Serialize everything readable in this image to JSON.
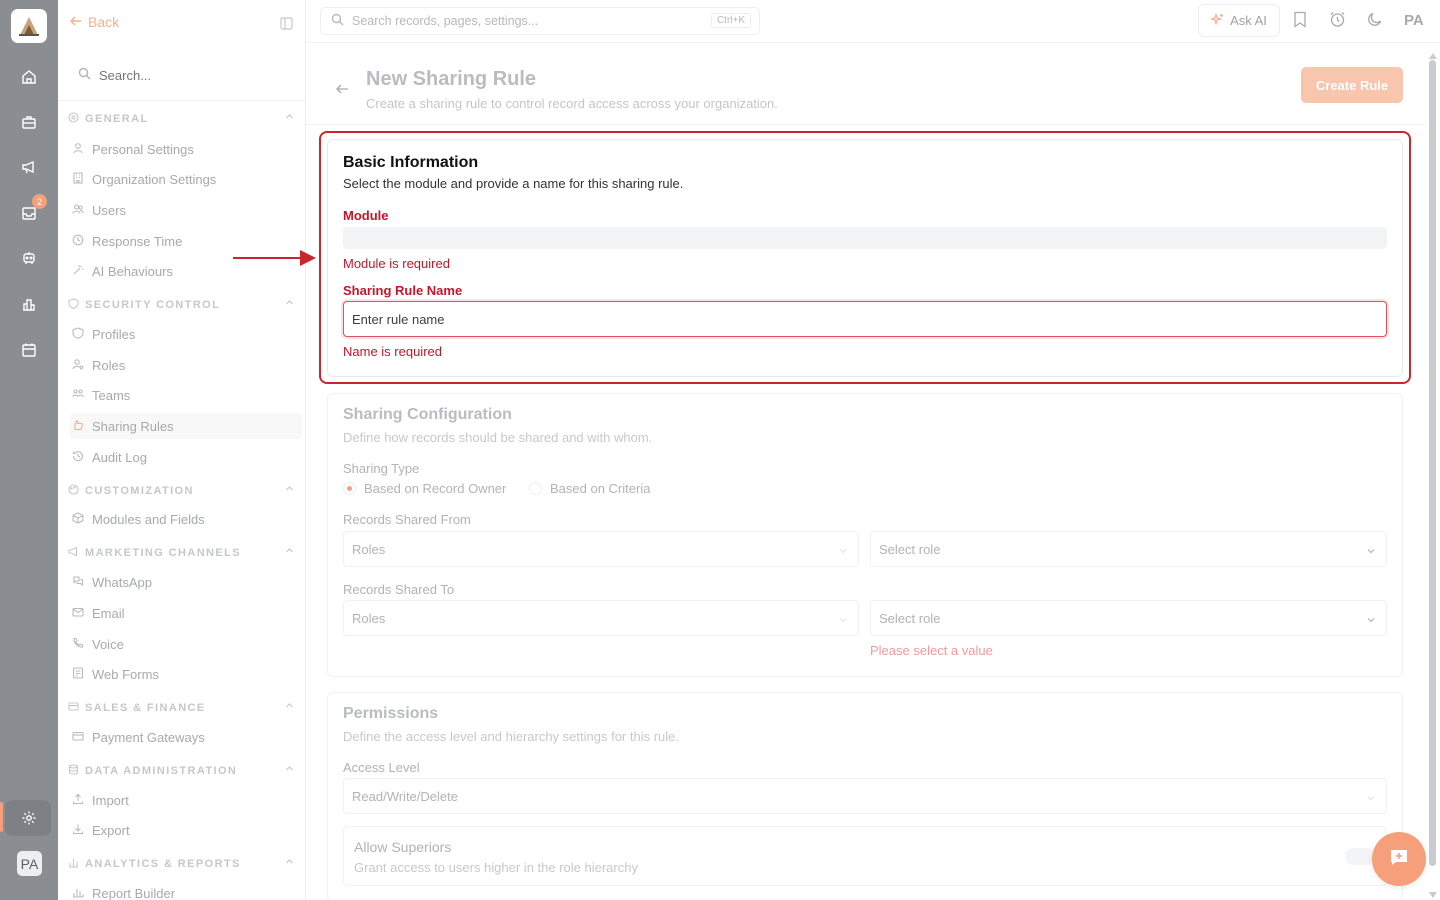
{
  "rail": {
    "badge_count": "2",
    "avatar": "PA",
    "icons": [
      "home-icon",
      "briefcase-icon",
      "megaphone-icon",
      "inbox-icon",
      "robot-icon",
      "bar-chart-icon",
      "calendar-icon",
      "settings-icon"
    ]
  },
  "sidebar": {
    "back_label": "Back",
    "search_placeholder": "Search...",
    "sections": {
      "general": "GENERAL",
      "security": "SECURITY CONTROL",
      "customization": "CUSTOMIZATION",
      "marketing": "MARKETING CHANNELS",
      "sales": "SALES & FINANCE",
      "data": "DATA ADMINISTRATION",
      "analytics": "ANALYTICS & REPORTS"
    },
    "items": {
      "personal": "Personal Settings",
      "organization": "Organization Settings",
      "users": "Users",
      "response": "Response Time",
      "ai": "AI Behaviours",
      "profiles": "Profiles",
      "roles": "Roles",
      "teams": "Teams",
      "sharing": "Sharing Rules",
      "audit": "Audit Log",
      "modules": "Modules and Fields",
      "whatsapp": "WhatsApp",
      "email": "Email",
      "voice": "Voice",
      "webforms": "Web Forms",
      "payment": "Payment Gateways",
      "import": "Import",
      "export": "Export",
      "report": "Report Builder"
    }
  },
  "topbar": {
    "search_placeholder": "Search records, pages, settings...",
    "shortcut": "Ctrl+K",
    "ask_ai": "Ask AI",
    "avatar": "PA"
  },
  "page": {
    "title": "New Sharing Rule",
    "subtitle": "Create a sharing rule to control record access across your organization.",
    "create_button": "Create Rule"
  },
  "basic": {
    "title": "Basic Information",
    "subtitle": "Select the module and provide a name for this sharing rule.",
    "module_label": "Module",
    "module_error": "Module is required",
    "name_label": "Sharing Rule Name",
    "name_placeholder": "Enter rule name",
    "name_error": "Name is required"
  },
  "config": {
    "title": "Sharing Configuration",
    "subtitle": "Define how records should be shared and with whom.",
    "type_label": "Sharing Type",
    "type_owner": "Based on Record Owner",
    "type_criteria": "Based on Criteria",
    "from_label": "Records Shared From",
    "from_type": "Roles",
    "from_value": "Select role",
    "to_label": "Records Shared To",
    "to_type": "Roles",
    "to_value": "Select role",
    "to_error": "Please select a value"
  },
  "permissions": {
    "title": "Permissions",
    "subtitle": "Define the access level and hierarchy settings for this rule.",
    "access_label": "Access Level",
    "access_value": "Read/Write/Delete",
    "superiors_title": "Allow Superiors",
    "superiors_sub": "Grant access to users higher in the role hierarchy"
  },
  "colors": {
    "accent": "#f6a07b",
    "error": "#c4152b",
    "highlight": "#c8282b",
    "rail": "#8a8d91"
  }
}
